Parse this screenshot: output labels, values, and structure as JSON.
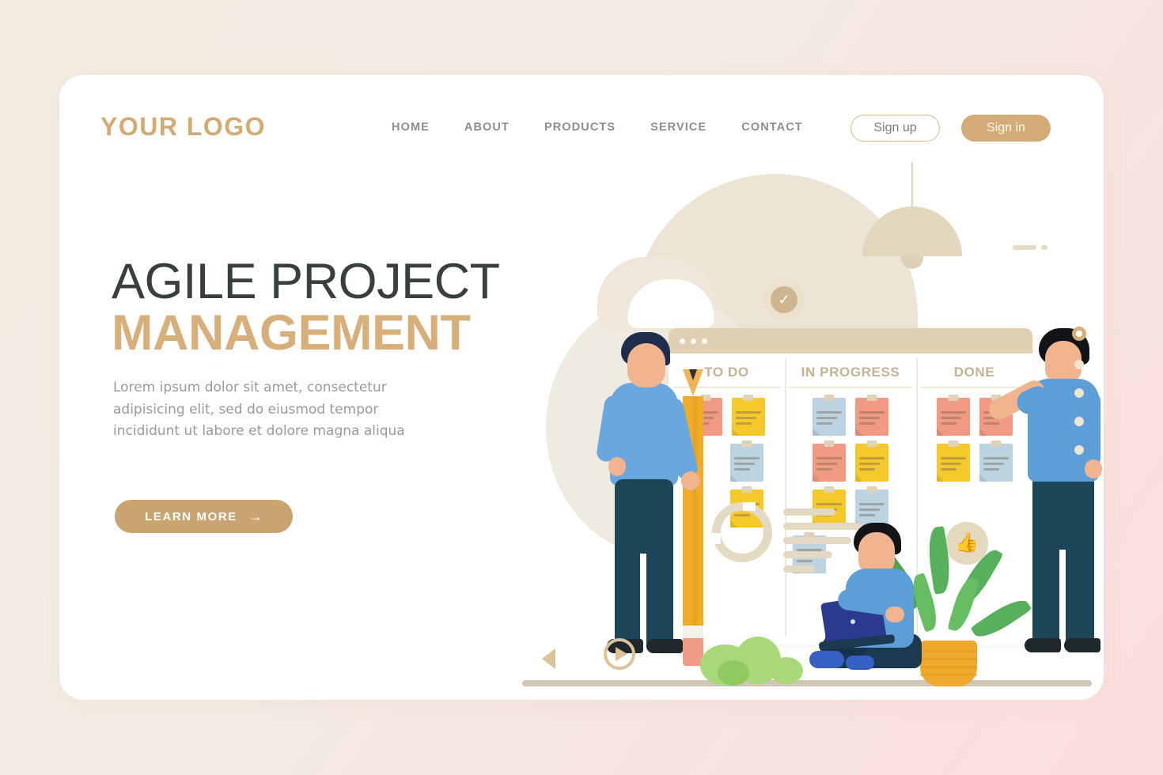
{
  "brand": {
    "logo": "YOUR LOGO",
    "accent": "#d3ab72"
  },
  "nav": {
    "items": [
      {
        "label": "HOME"
      },
      {
        "label": "ABOUT"
      },
      {
        "label": "PRODUCTS"
      },
      {
        "label": "SERVICE"
      },
      {
        "label": "CONTACT"
      }
    ],
    "sign_up": "Sign up",
    "sign_in": "Sign in"
  },
  "hero": {
    "title_line1": "AGILE PROJECT",
    "title_line2": "MANAGEMENT",
    "paragraph": "Lorem ipsum dolor sit amet, consectetur adipisicing elit, sed do eiusmod tempor incididunt ut labore et dolore magna aliqua",
    "cta_label": "LEARN MORE",
    "cta_arrow": "→"
  },
  "board": {
    "columns": [
      {
        "title": "TO DO",
        "notes": [
          "red",
          "yellow",
          "blue",
          "yellow"
        ]
      },
      {
        "title": "IN PROGRESS",
        "notes": [
          "blue",
          "red",
          "red",
          "yellow",
          "yellow",
          "blue",
          "blue"
        ]
      },
      {
        "title": "DONE",
        "notes": [
          "red",
          "red",
          "yellow",
          "blue"
        ]
      }
    ],
    "note_colors": {
      "red": "#f09a84",
      "yellow": "#f6c92a",
      "blue": "#bcd4e2"
    }
  },
  "badges": {
    "check": "✓",
    "thumbs_up": "👍"
  },
  "carousel": {
    "prev_label": "previous",
    "play_label": "play",
    "dots": [
      "active",
      "dim",
      "dim",
      "dim",
      "dim"
    ]
  }
}
